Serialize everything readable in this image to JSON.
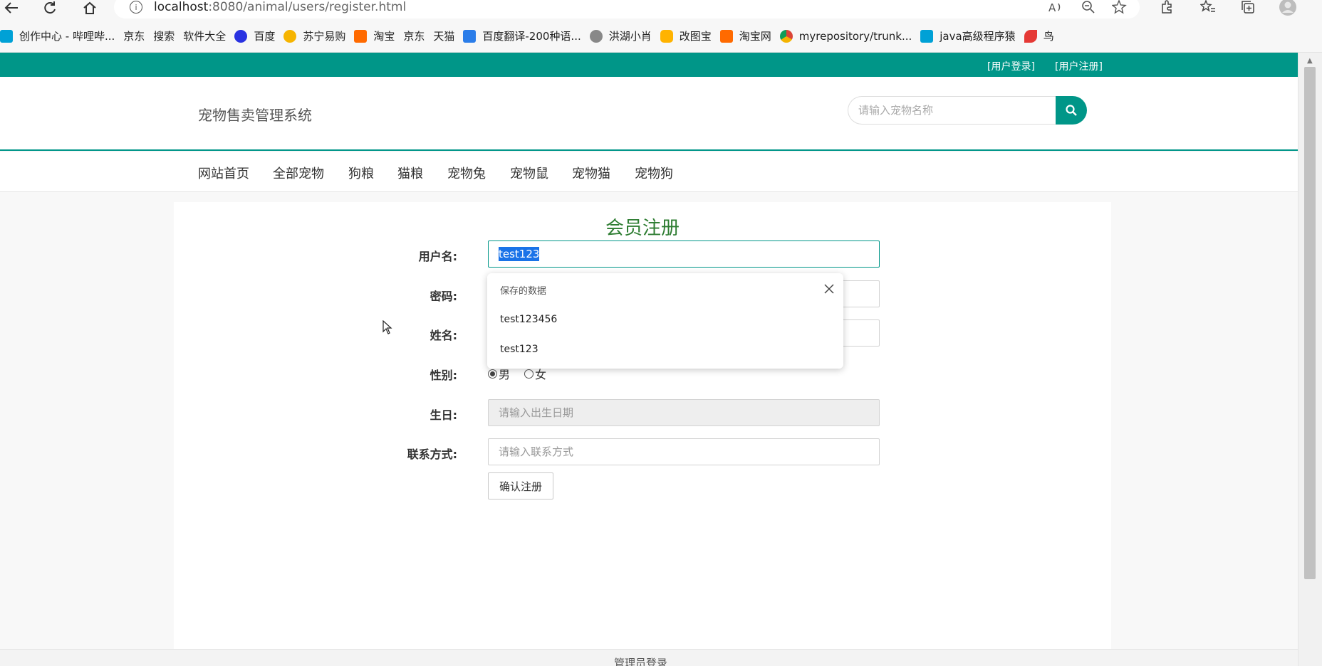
{
  "browser": {
    "url_host": "localhost",
    "url_path": ":8080/animal/users/register.html",
    "back_icon": "arrow-left-icon",
    "refresh_icon": "refresh-icon",
    "home_icon": "home-icon",
    "info_glyph": "i"
  },
  "bookmarks": [
    {
      "label": "创作中心 - 哔哩哔...",
      "icon": "bilibili-icon"
    },
    {
      "label": "京东",
      "icon": "page-icon"
    },
    {
      "label": "搜索",
      "icon": "page-icon"
    },
    {
      "label": "软件大全",
      "icon": "page-icon"
    },
    {
      "label": "百度",
      "icon": "baidu-icon"
    },
    {
      "label": "苏宁易购",
      "icon": "suning-icon"
    },
    {
      "label": "淘宝",
      "icon": "taobao-icon"
    },
    {
      "label": "京东",
      "icon": "page-icon"
    },
    {
      "label": "天猫",
      "icon": "page-icon"
    },
    {
      "label": "百度翻译-200种语...",
      "icon": "translate-icon"
    },
    {
      "label": "洪湖小肖",
      "icon": "honghu-icon"
    },
    {
      "label": "改图宝",
      "icon": "gaitubao-icon"
    },
    {
      "label": "淘宝网",
      "icon": "taobao-icon"
    },
    {
      "label": "myrepository/trunk...",
      "icon": "chrome-icon"
    },
    {
      "label": "java高级程序猿",
      "icon": "bilibili-icon"
    },
    {
      "label": "鸟",
      "icon": "bird-icon"
    }
  ],
  "topbar": {
    "login": "[用户登录]",
    "register": "[用户注册]"
  },
  "header": {
    "site_title": "宠物售卖管理系统",
    "search_placeholder": "请输入宠物名称"
  },
  "nav": [
    "网站首页",
    "全部宠物",
    "狗粮",
    "猫粮",
    "宠物兔",
    "宠物鼠",
    "宠物猫",
    "宠物狗"
  ],
  "form": {
    "title": "会员注册",
    "username_label": "用户名:",
    "username_value": "test123",
    "password_label": "密码:",
    "name_label": "姓名:",
    "gender_label": "性别:",
    "gender_male": "男",
    "gender_female": "女",
    "birthday_label": "生日:",
    "birthday_placeholder": "请输入出生日期",
    "contact_label": "联系方式:",
    "contact_placeholder": "请输入联系方式",
    "submit": "确认注册"
  },
  "autofill": {
    "header": "保存的数据",
    "options": [
      "test123456",
      "test123"
    ]
  },
  "footer": {
    "admin_login": "管理员登录"
  },
  "colors": {
    "accent": "#009688",
    "title_green": "#2e7d32",
    "selection": "#1a73e8"
  }
}
